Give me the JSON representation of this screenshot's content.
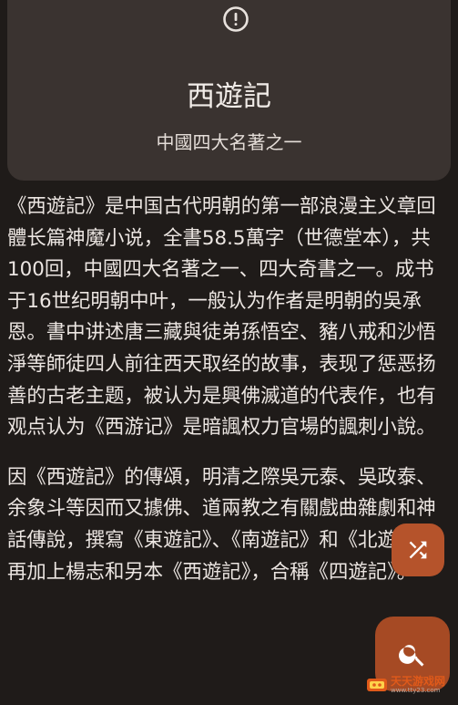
{
  "header_card": {
    "title": "西遊記",
    "subtitle": "中國四大名著之一"
  },
  "article": {
    "paragraphs": [
      "《西遊記》是中国古代明朝的第一部浪漫主义章回體长篇神魔小说，全書58.5萬字（世德堂本），共100回，中國四大名著之一、四大奇書之一。成书于16世纪明朝中叶，一般认为作者是明朝的吳承恩。書中讲述唐三藏與徒弟孫悟空、豬八戒和沙悟淨等師徒四人前往西天取经的故事，表现了惩恶扬善的古老主题，被认为是興佛滅道的代表作，也有观点认为《西游记》是暗諷权力官場的諷刺小說。",
      "因《西遊記》的傳頌，明清之際吳元泰、吳政泰、余象斗等因而又據佛、道兩教之有關戲曲雜劇和神話傳說，撰寫《東遊記》、《南遊記》和《北遊記》，再加上楊志和另本《西遊記》，合稱《四遊記》。"
    ]
  },
  "watermark": {
    "name": "天天游戏网",
    "url": "www.tty23.com"
  },
  "icons": {
    "info": "info-icon",
    "shuffle": "shuffle-icon",
    "search": "search-icon"
  },
  "colors": {
    "background": "#1f1b19",
    "card": "#3a3330",
    "accent": "#b5532b"
  }
}
